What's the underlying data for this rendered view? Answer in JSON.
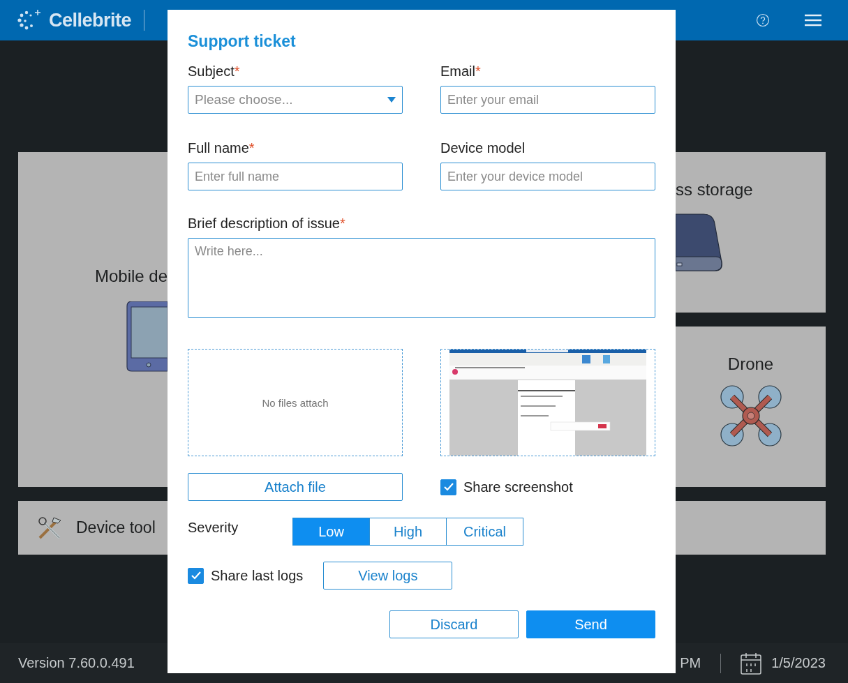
{
  "top_bar": {
    "brand": "Cellebrite"
  },
  "left_card": {
    "label": "Mobile de"
  },
  "right_cards": [
    {
      "label": "ss storage",
      "kind": "storage"
    },
    {
      "label": "Drone",
      "kind": "drone"
    }
  ],
  "tools_bar": {
    "label": "Device tool"
  },
  "status_bar": {
    "version": "Version 7.60.0.491",
    "time": "PM",
    "date": "1/5/2023"
  },
  "dialog": {
    "title": "Support ticket",
    "fields": [
      {
        "label": "Subject",
        "required_mark": "*",
        "kind": "select",
        "placeholder": "Please choose..."
      },
      {
        "label": "Email",
        "required_mark": "*",
        "kind": "text",
        "placeholder": "Enter your email"
      },
      {
        "label": "Full name",
        "required_mark": "*",
        "kind": "text",
        "placeholder": "Enter full name"
      },
      {
        "label": "Device model",
        "kind": "text",
        "placeholder": "Enter your device model"
      }
    ],
    "description": {
      "label": "Brief description of issue",
      "required_mark": "*",
      "placeholder": "Write here..."
    },
    "attachments": {
      "empty_text": "No files attach"
    },
    "attach_button": "Attach file",
    "share_screenshot": {
      "label": "Share screenshot",
      "checked": true
    },
    "severity": {
      "label": "Severity",
      "options": [
        {
          "label": "Low",
          "selected": true
        },
        {
          "label": "High",
          "selected": false
        },
        {
          "label": "Critical",
          "selected": false
        }
      ]
    },
    "share_logs": {
      "label": "Share last logs",
      "checked": true
    },
    "view_logs_button": "View logs",
    "buttons": [
      {
        "label": "Discard",
        "primary": false
      },
      {
        "label": "Send",
        "primary": true
      }
    ]
  }
}
